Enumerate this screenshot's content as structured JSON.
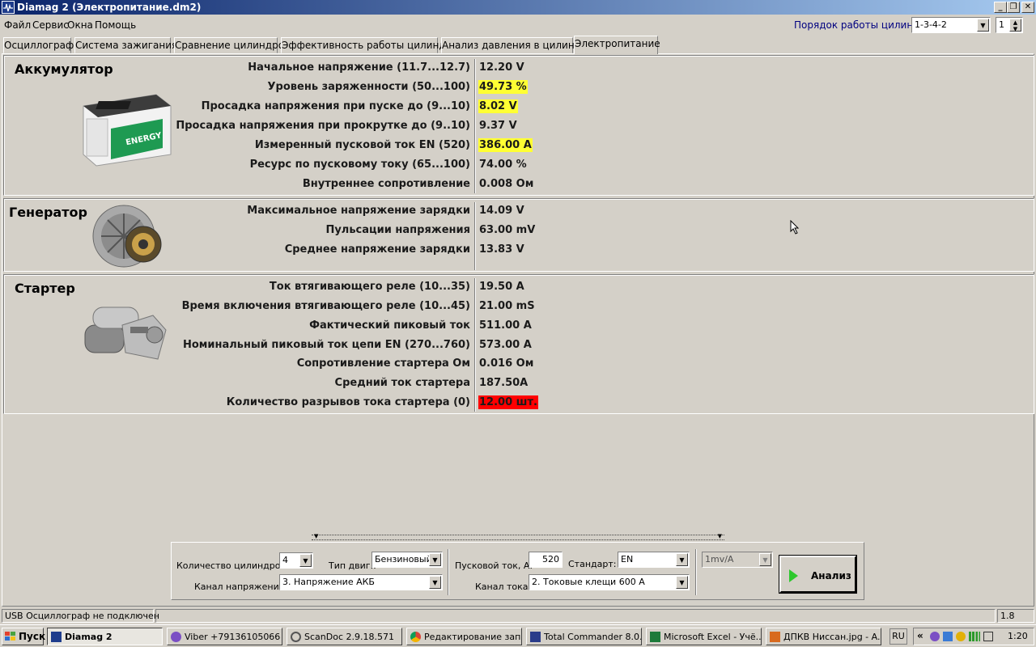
{
  "window": {
    "title": "Diamag 2 (Электропитание.dm2)"
  },
  "menu": [
    "Файл",
    "Сервис",
    "Окна",
    "Помощь"
  ],
  "cylinder_order": {
    "label": "Порядок работы цилиндров",
    "value": "1-3-4-2",
    "spin": "1"
  },
  "tabs": [
    "Осциллограф",
    "Система зажигания",
    "Сравнение цилиндров",
    "Эффективность работы цилиндров",
    "Анализ давления в цилиндре",
    "Электропитание"
  ],
  "active_tab": "Электропитание",
  "battery": {
    "title": "Аккумулятор",
    "rows": [
      {
        "label": "Начальное напряжение (11.7...12.7)",
        "value": "12.20 V"
      },
      {
        "label": "Уровень заряженности (50...100)",
        "value": "49.73 %"
      },
      {
        "label": "Просадка напряжения при пуске до (9...10)",
        "value": "8.02 V"
      },
      {
        "label": "Просадка напряжения при прокрутке до  (9..10)",
        "value": "9.37 V"
      },
      {
        "label": "Измеренный пусковой ток  EN (520)",
        "value": "386.00 A"
      },
      {
        "label": "Ресурс по пусковому току (65...100)",
        "value": "74.00 %"
      },
      {
        "label": "Внутреннее сопротивление",
        "value": "0.008 Ом"
      }
    ],
    "battery_label": "ENERGY"
  },
  "generator": {
    "title": "Генератор",
    "rows": [
      {
        "label": "Максимальное напряжение зарядки",
        "value": "14.09 V"
      },
      {
        "label": "Пульсации напряжения",
        "value": "63.00 mV"
      },
      {
        "label": "Среднее напряжение зарядки",
        "value": "13.83 V"
      }
    ]
  },
  "starter": {
    "title": "Стартер",
    "rows": [
      {
        "label": "Ток втягивающего реле (10...35)",
        "value": "19.50 A"
      },
      {
        "label": "Время включения втягивающего реле (10...45)",
        "value": "21.00 mS"
      },
      {
        "label": "Фактический пиковый ток",
        "value": "511.00 A"
      },
      {
        "label": "Номинальный пиковый ток цепи EN (270...760)",
        "value": "573.00 A"
      },
      {
        "label": "Сопротивление стартера Ом",
        "value": "0.016 Ом"
      },
      {
        "label": "Средний ток стартера",
        "value": "187.50A"
      },
      {
        "label": "Количество разрывов тока стартера (0)",
        "value": "12.00 шт."
      }
    ]
  },
  "settings": {
    "cyl_count_label": "Количество цилиндров:",
    "cyl_count": "4",
    "engine_type_label": "Тип двиг.:",
    "engine_type": "Бензиновый",
    "voltage_channel_label": "Канал напряжения:",
    "voltage_channel": "3.  Напряжение АКБ",
    "start_current_label": "Пусковой ток, А:",
    "start_current": "520",
    "standard_label": "Стандарт:",
    "standard": "EN",
    "current_channel_label": "Канал тока:",
    "current_channel": "2.  Токовые клещи 600 А",
    "scale": "1mv/A",
    "analyze_label": "Анализ"
  },
  "status": {
    "left": "USB Осциллограф не подключен",
    "right": "1.8"
  },
  "taskbar": {
    "start": "Пуск",
    "tasks": [
      "Diamag 2",
      "Viber +79136105066",
      "ScanDoc 2.9.18.571",
      "Редактирование зап...",
      "Total Commander 8.0...",
      "Microsoft Excel - Учё...",
      "ДПКВ Ниссан.jpg - A..."
    ],
    "lang": "RU",
    "clock": "1:20"
  },
  "colors": {
    "highlight_yellow": "#ffff33",
    "highlight_red": "#ff0000",
    "title_gradient_start": "#0a246a",
    "face": "#d4d0c8"
  }
}
